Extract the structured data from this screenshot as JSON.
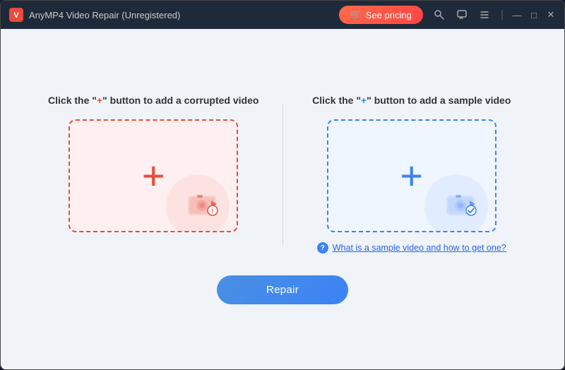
{
  "titlebar": {
    "logo_label": "AnyMP4 Video Repair",
    "title": "AnyMP4 Video Repair (Unregistered)",
    "pricing_button": "See pricing",
    "min_label": "—",
    "max_label": "□",
    "close_label": "✕"
  },
  "left_panel": {
    "label_prefix": "Click the \"",
    "label_plus": "+",
    "label_suffix": "\" button to add a corrupted video",
    "plus_symbol": "+",
    "deco_title": "corrupted-video-drop-zone"
  },
  "right_panel": {
    "label_prefix": "Click the \"",
    "label_plus": "+",
    "label_suffix": "\" button to add a sample video",
    "plus_symbol": "+",
    "help_link": "What is a sample video and how to get one?"
  },
  "repair_button": {
    "label": "Repair"
  },
  "icons": {
    "pricing_cart": "🛒",
    "help_circle": "?",
    "key_icon": "🔑",
    "chat_icon": "💬",
    "menu_icon": "☰"
  }
}
